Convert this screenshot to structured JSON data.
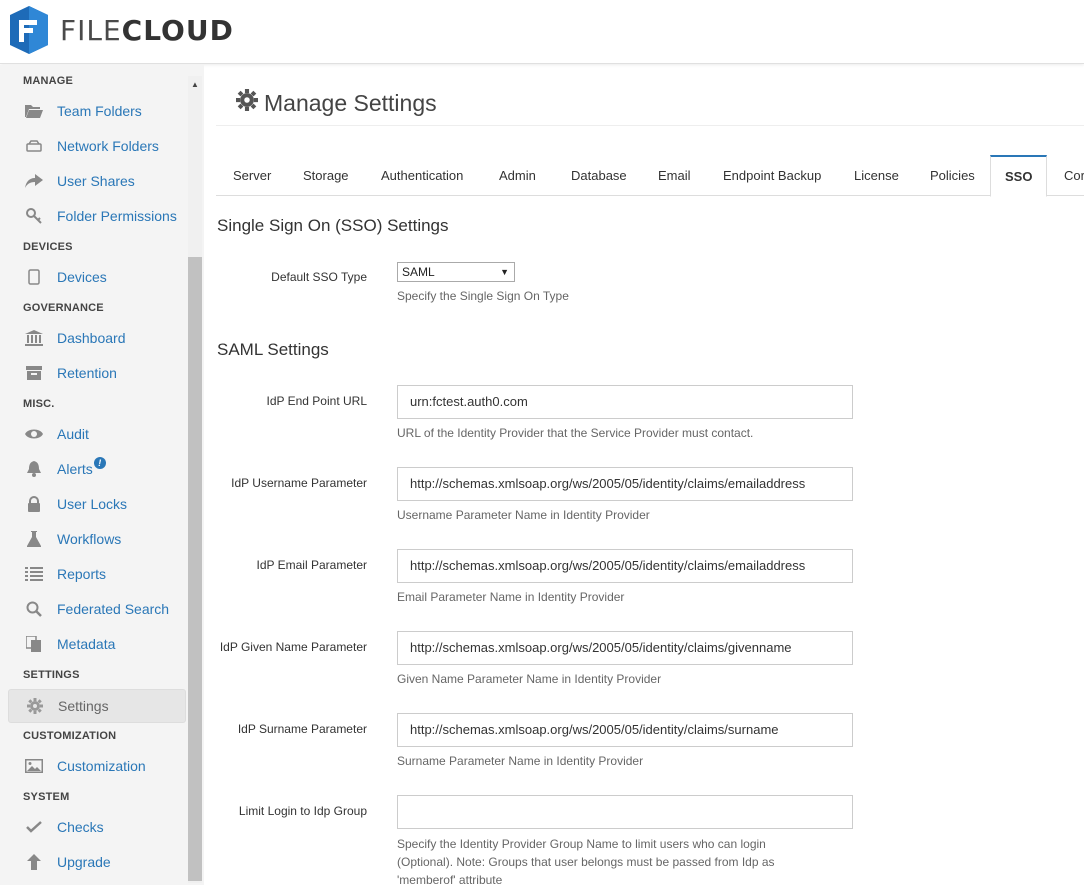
{
  "brand": {
    "name_light": "FILE",
    "name_bold": "CLOUD"
  },
  "sidebar": {
    "sections": [
      {
        "heading": "MANAGE",
        "items": [
          {
            "label": "Team Folders",
            "icon": "folder-open-icon"
          },
          {
            "label": "Network Folders",
            "icon": "hdd-icon"
          },
          {
            "label": "User Shares",
            "icon": "share-icon"
          },
          {
            "label": "Folder Permissions",
            "icon": "key-icon"
          }
        ]
      },
      {
        "heading": "DEVICES",
        "items": [
          {
            "label": "Devices",
            "icon": "tablet-icon"
          }
        ]
      },
      {
        "heading": "GOVERNANCE",
        "items": [
          {
            "label": "Dashboard",
            "icon": "bank-icon"
          },
          {
            "label": "Retention",
            "icon": "archive-icon"
          }
        ]
      },
      {
        "heading": "MISC.",
        "items": [
          {
            "label": "Audit",
            "icon": "eye-icon"
          },
          {
            "label": "Alerts",
            "icon": "bell-icon",
            "badge": "!"
          },
          {
            "label": "User Locks",
            "icon": "lock-icon"
          },
          {
            "label": "Workflows",
            "icon": "flask-icon"
          },
          {
            "label": "Reports",
            "icon": "list-icon"
          },
          {
            "label": "Federated Search",
            "icon": "search-icon"
          },
          {
            "label": "Metadata",
            "icon": "copy-icon"
          }
        ]
      },
      {
        "heading": "SETTINGS",
        "items": [
          {
            "label": "Settings",
            "icon": "gear-icon",
            "active": true
          }
        ]
      },
      {
        "heading": "CUSTOMIZATION",
        "items": [
          {
            "label": "Customization",
            "icon": "image-icon"
          }
        ]
      },
      {
        "heading": "SYSTEM",
        "items": [
          {
            "label": "Checks",
            "icon": "check-icon"
          },
          {
            "label": "Upgrade",
            "icon": "arrow-up-icon"
          }
        ]
      }
    ]
  },
  "page": {
    "title": "Manage Settings"
  },
  "tabs": [
    "Server",
    "Storage",
    "Authentication",
    "Admin",
    "Database",
    "Email",
    "Endpoint Backup",
    "License",
    "Policies",
    "SSO",
    "Cor"
  ],
  "active_tab": "SSO",
  "sso": {
    "heading": "Single Sign On (SSO) Settings",
    "type_label": "Default SSO Type",
    "type_value": "SAML",
    "type_help": "Specify the Single Sign On Type"
  },
  "saml": {
    "heading": "SAML Settings",
    "fields": [
      {
        "label": "IdP End Point URL",
        "value": "urn:fctest.auth0.com",
        "help": "URL of the Identity Provider that the Service Provider must contact."
      },
      {
        "label": "IdP Username Parameter",
        "value": "http://schemas.xmlsoap.org/ws/2005/05/identity/claims/emailaddress",
        "help": "Username Parameter Name in Identity Provider"
      },
      {
        "label": "IdP Email Parameter",
        "value": "http://schemas.xmlsoap.org/ws/2005/05/identity/claims/emailaddress",
        "help": "Email Parameter Name in Identity Provider"
      },
      {
        "label": "IdP Given Name Parameter",
        "value": "http://schemas.xmlsoap.org/ws/2005/05/identity/claims/givenname",
        "help": "Given Name Parameter Name in Identity Provider"
      },
      {
        "label": "IdP Surname Parameter",
        "value": "http://schemas.xmlsoap.org/ws/2005/05/identity/claims/surname",
        "help": "Surname Parameter Name in Identity Provider"
      },
      {
        "label": "Limit Login to Idp Group",
        "value": "",
        "help": "Specify the Identity Provider Group Name to limit users who can login (Optional). Note: Groups that user belongs must be passed from Idp as 'memberof' attribute"
      }
    ]
  },
  "colors": {
    "link": "#2a77b7",
    "brand_blue": "#1e6bb8"
  }
}
